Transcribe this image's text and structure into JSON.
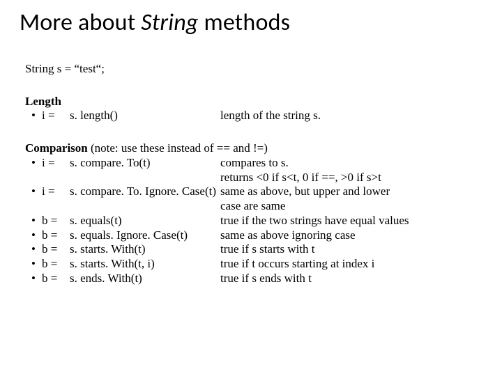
{
  "title": {
    "prefix": "More about ",
    "italic": "String",
    "suffix": " methods"
  },
  "declaration": "String s = “test“;",
  "length": {
    "heading": "Length",
    "rows": [
      {
        "bullet": "•",
        "var": "i =",
        "expr": "s. length()",
        "desc": "length of the string s."
      }
    ]
  },
  "comparison": {
    "heading": "Comparison",
    "heading_note": " (note: use these instead of == and !=)",
    "rows": [
      {
        "bullet": "•",
        "var": "i =",
        "expr": "s. compare. To(t)",
        "desc": "compares to s."
      },
      {
        "bullet": "",
        "var": "",
        "expr": "",
        "desc": "returns <0 if s<t, 0 if ==, >0 if s>t"
      },
      {
        "bullet": "•",
        "var": "i =",
        "expr": "s. compare. To. Ignore. Case(t)",
        "desc": "same as above, but upper and lower"
      },
      {
        "bullet": "",
        "var": "",
        "expr": "",
        "desc": "case are same"
      },
      {
        "bullet": "•",
        "var": "b =",
        "expr": "s. equals(t)",
        "desc": "true if the two strings have equal values"
      },
      {
        "bullet": "•",
        "var": "b =",
        "expr": "s. equals. Ignore. Case(t)",
        "desc": "same as above ignoring case"
      },
      {
        "bullet": "•",
        "var": "b =",
        "expr": "s. starts. With(t)",
        "desc": "true if s starts with t"
      },
      {
        "bullet": "•",
        "var": "b =",
        "expr": "s. starts. With(t, i)",
        "desc": "true if t occurs starting at index i"
      },
      {
        "bullet": "•",
        "var": "b =",
        "expr": "s. ends. With(t)",
        "desc": "true if s ends with t"
      }
    ]
  }
}
